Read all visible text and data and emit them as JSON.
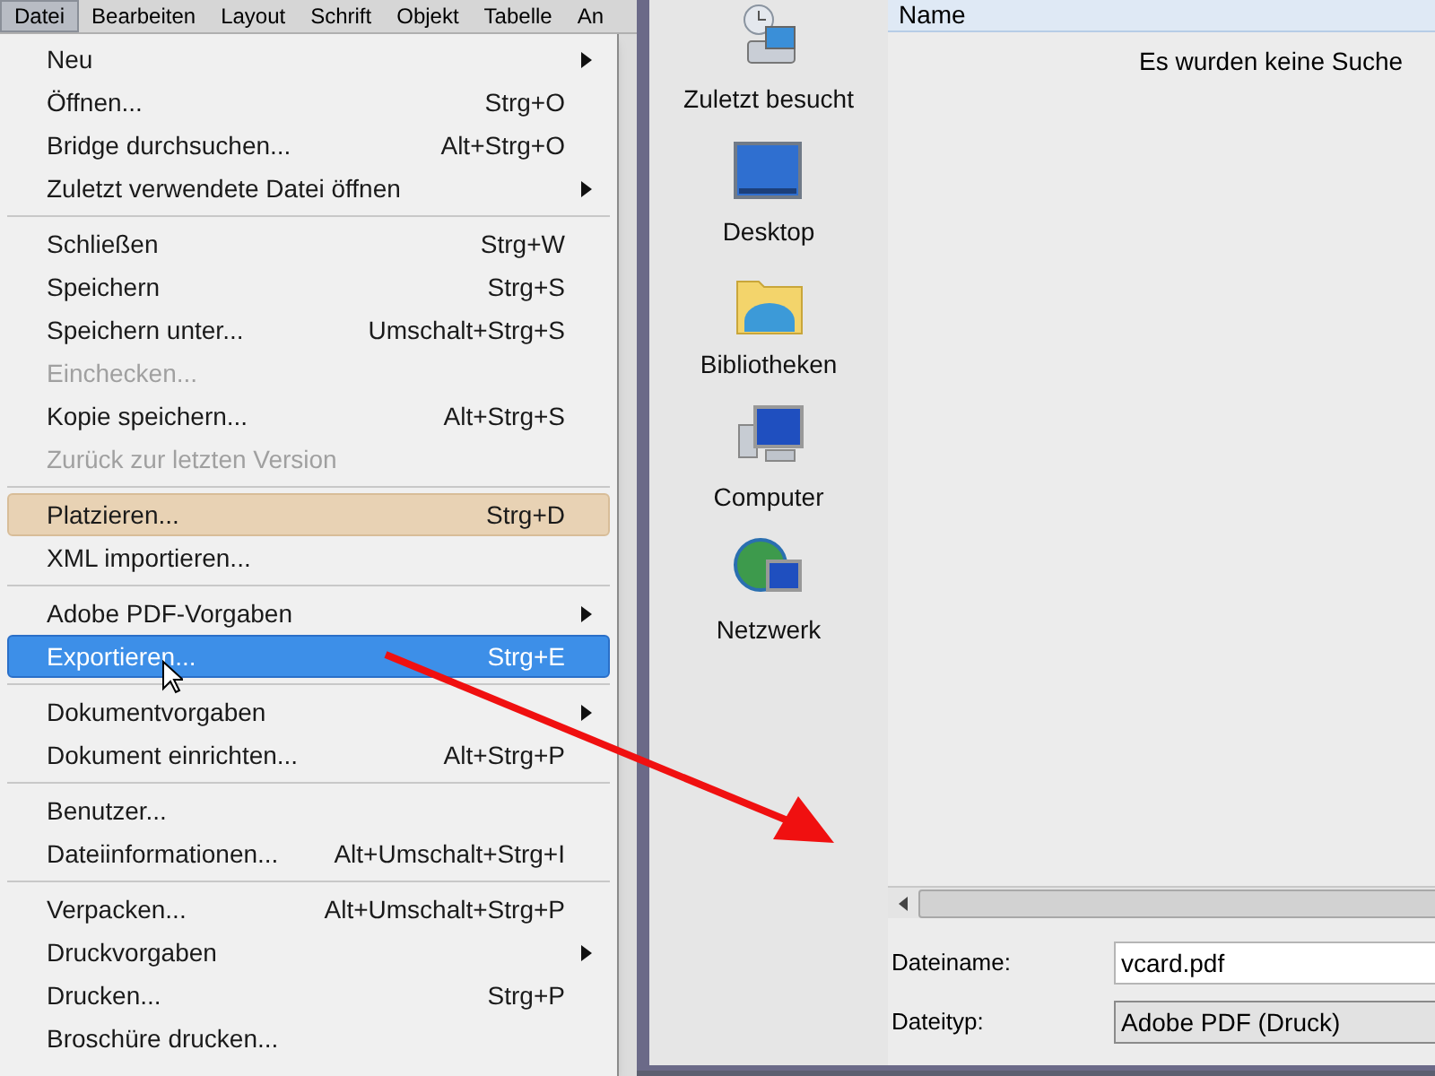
{
  "menubar": [
    {
      "label": "Datei",
      "selected": true
    },
    {
      "label": "Bearbeiten",
      "selected": false
    },
    {
      "label": "Layout",
      "selected": false
    },
    {
      "label": "Schrift",
      "selected": false
    },
    {
      "label": "Objekt",
      "selected": false
    },
    {
      "label": "Tabelle",
      "selected": false
    },
    {
      "label": "An",
      "selected": false
    }
  ],
  "menu": [
    [
      {
        "label": "Neu",
        "submenu": true,
        "selected": false
      },
      {
        "label": "Öffnen...",
        "shortcut": "Strg+O",
        "selected": false
      },
      {
        "label": "Bridge durchsuchen...",
        "shortcut": "Alt+Strg+O",
        "selected": false
      },
      {
        "label": "Zuletzt verwendete Datei öffnen",
        "submenu": true,
        "selected": false
      }
    ],
    [
      {
        "label": "Schließen",
        "shortcut": "Strg+W",
        "selected": false
      },
      {
        "label": "Speichern",
        "shortcut": "Strg+S",
        "selected": false
      },
      {
        "label": "Speichern unter...",
        "shortcut": "Umschalt+Strg+S",
        "selected": false
      },
      {
        "label": "Einchecken...",
        "disabled": true,
        "selected": false
      },
      {
        "label": "Kopie speichern...",
        "shortcut": "Alt+Strg+S",
        "selected": false
      },
      {
        "label": "Zurück zur letzten Version",
        "disabled": true,
        "selected": false
      }
    ],
    [
      {
        "label": "Platzieren...",
        "shortcut": "Strg+D",
        "highlighted": true,
        "selected": false
      },
      {
        "label": "XML importieren...",
        "selected": false
      }
    ],
    [
      {
        "label": "Adobe PDF-Vorgaben",
        "submenu": true,
        "selected": false
      },
      {
        "label": "Exportieren...",
        "shortcut": "Strg+E",
        "selected": true
      }
    ],
    [
      {
        "label": "Dokumentvorgaben",
        "submenu": true,
        "selected": false
      },
      {
        "label": "Dokument einrichten...",
        "shortcut": "Alt+Strg+P",
        "selected": false
      }
    ],
    [
      {
        "label": "Benutzer...",
        "selected": false
      },
      {
        "label": "Dateiinformationen...",
        "shortcut": "Alt+Umschalt+Strg+I",
        "selected": false
      }
    ],
    [
      {
        "label": "Verpacken...",
        "shortcut": "Alt+Umschalt+Strg+P",
        "selected": false
      },
      {
        "label": "Druckvorgaben",
        "submenu": true,
        "selected": false
      },
      {
        "label": "Drucken...",
        "shortcut": "Strg+P",
        "selected": false
      },
      {
        "label": "Broschüre drucken...",
        "selected": false
      }
    ]
  ],
  "dialog": {
    "places": [
      {
        "kind": "recent",
        "label": "Zuletzt besucht"
      },
      {
        "kind": "desktop",
        "label": "Desktop"
      },
      {
        "kind": "libraries",
        "label": "Bibliotheken"
      },
      {
        "kind": "computer",
        "label": "Computer"
      },
      {
        "kind": "network",
        "label": "Netzwerk"
      }
    ],
    "column_header": "Name",
    "message": "Es wurden keine Suche",
    "filename": {
      "label": "Dateiname:",
      "value": "vcard.pdf"
    },
    "filetype": {
      "label": "Dateityp:",
      "value": "Adobe PDF (Druck)"
    }
  }
}
